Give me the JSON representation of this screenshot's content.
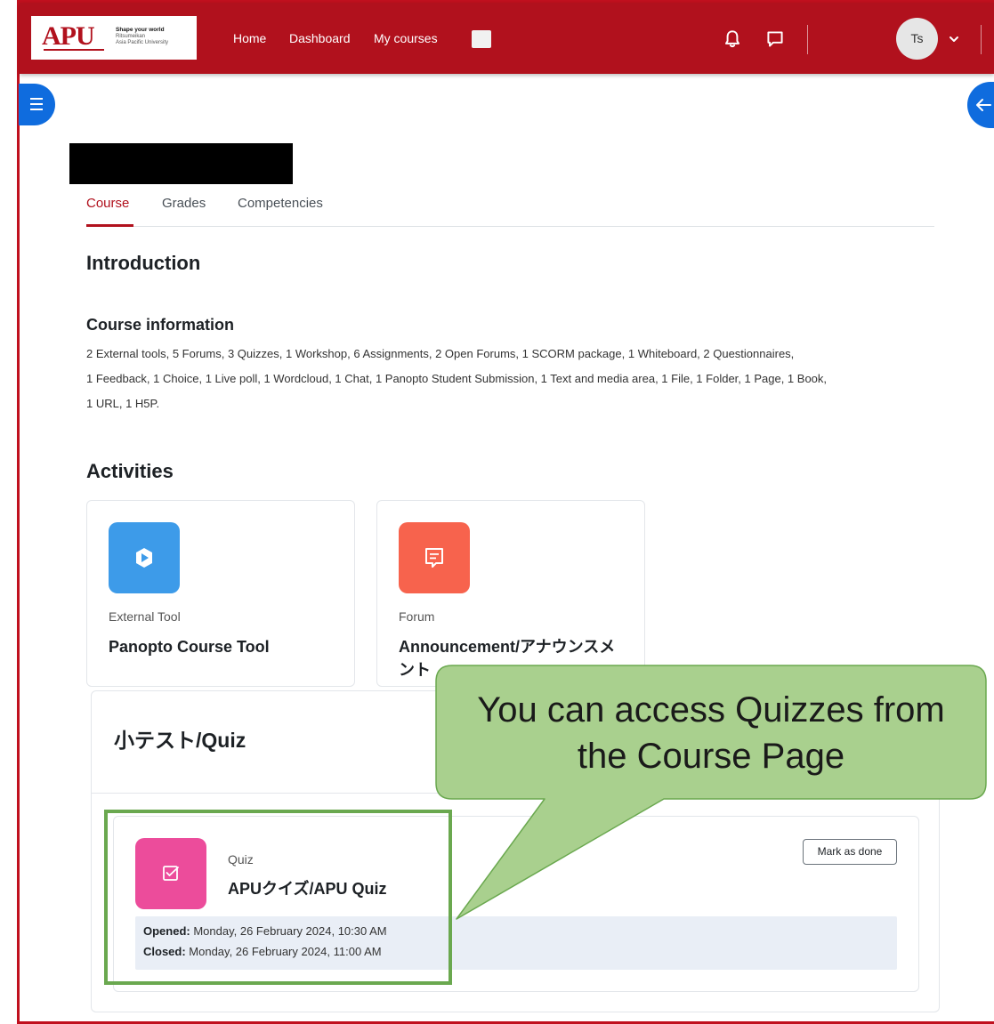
{
  "navbar": {
    "logo": {
      "mark": "APU",
      "tagline": "Shape your world",
      "line1": "Ritsumeikan",
      "line2": "Asia Pacific University"
    },
    "links": [
      "Home",
      "Dashboard",
      "My courses"
    ],
    "icons": [
      "bell-icon",
      "chat-icon"
    ],
    "user_initials": "Ts",
    "brand_color": "#b1111d"
  },
  "course_tabs": [
    "Course",
    "Grades",
    "Competencies"
  ],
  "introduction": {
    "heading": "Introduction",
    "info_heading": "Course information",
    "info_lines": [
      "2 External tools, 5 Forums, 3 Quizzes, 1 Workshop, 6 Assignments, 2 Open Forums, 1 SCORM package, 1 Whiteboard, 2 Questionnaires,",
      "1 Feedback, 1 Choice, 1 Live poll, 1 Wordcloud, 1 Chat, 1 Panopto Student Submission, 1 Text and media area, 1 File, 1 Folder, 1 Page, 1 Book,",
      "1 URL, 1 H5P."
    ]
  },
  "activities": {
    "heading": "Activities",
    "items": [
      {
        "type": "External Tool",
        "name": "Panopto Course Tool",
        "color": "#3d9be9"
      },
      {
        "type": "Forum",
        "name": "Announcement/アナウンスメント",
        "color": "#f7634d"
      }
    ]
  },
  "quiz_section": {
    "title": "小テスト/Quiz",
    "item": {
      "type": "Quiz",
      "name": "APUクイズ/APU Quiz",
      "color": "#ec4c9b",
      "mark_label": "Mark as done",
      "opened_label": "Opened:",
      "opened_value": " Monday, 26 February 2024, 10:30 AM",
      "closed_label": "Closed:",
      "closed_value": " Monday, 26 February 2024, 11:00 AM"
    }
  },
  "callout": {
    "line1": "You can access Quizzes from",
    "line2": "the Course Page",
    "fill": "#a9d08e",
    "border": "#6aa84f"
  }
}
